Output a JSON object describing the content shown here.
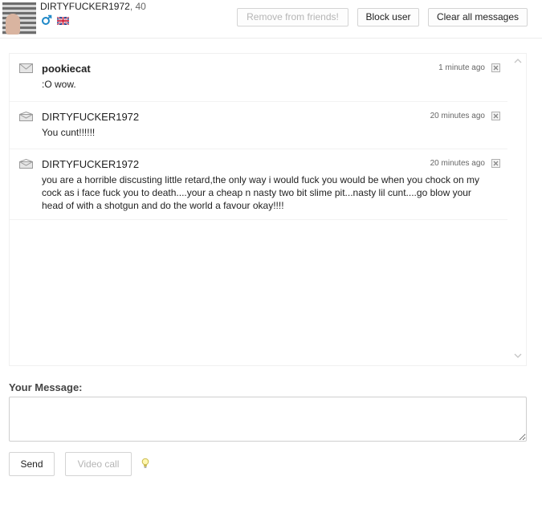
{
  "header": {
    "username": "DIRTYFUCKER1972",
    "age": ", 40",
    "icons": {
      "gender": "male-icon",
      "flag": "uk-flag-icon"
    },
    "buttons": {
      "remove": "Remove from friends!",
      "block": "Block user",
      "clear": "Clear all messages"
    }
  },
  "messages": [
    {
      "sender": "pookiecat",
      "time": "1 minute ago",
      "body": ":O wow.",
      "icon": "envelope-icon"
    },
    {
      "sender": "DIRTYFUCKER1972",
      "time": "20 minutes ago",
      "body": "You cunt!!!!!!",
      "icon": "envelope-open-icon"
    },
    {
      "sender": "DIRTYFUCKER1972",
      "time": "20 minutes ago",
      "body": "you are a horrible discusting little retard,the only way i would fuck you would be when you chock on my cock as i face fuck you to death....your a cheap n nasty two bit slime pit...nasty lil cunt....go blow your head of with a shotgun and do the world a favour okay!!!!",
      "icon": "envelope-open-icon"
    }
  ],
  "compose": {
    "label": "Your Message:",
    "value": "",
    "send": "Send",
    "video_call": "Video call"
  },
  "colors": {
    "border": "#d4d4d4",
    "disabled_text": "#b5b5b5",
    "male_blue": "#1e88c8"
  }
}
